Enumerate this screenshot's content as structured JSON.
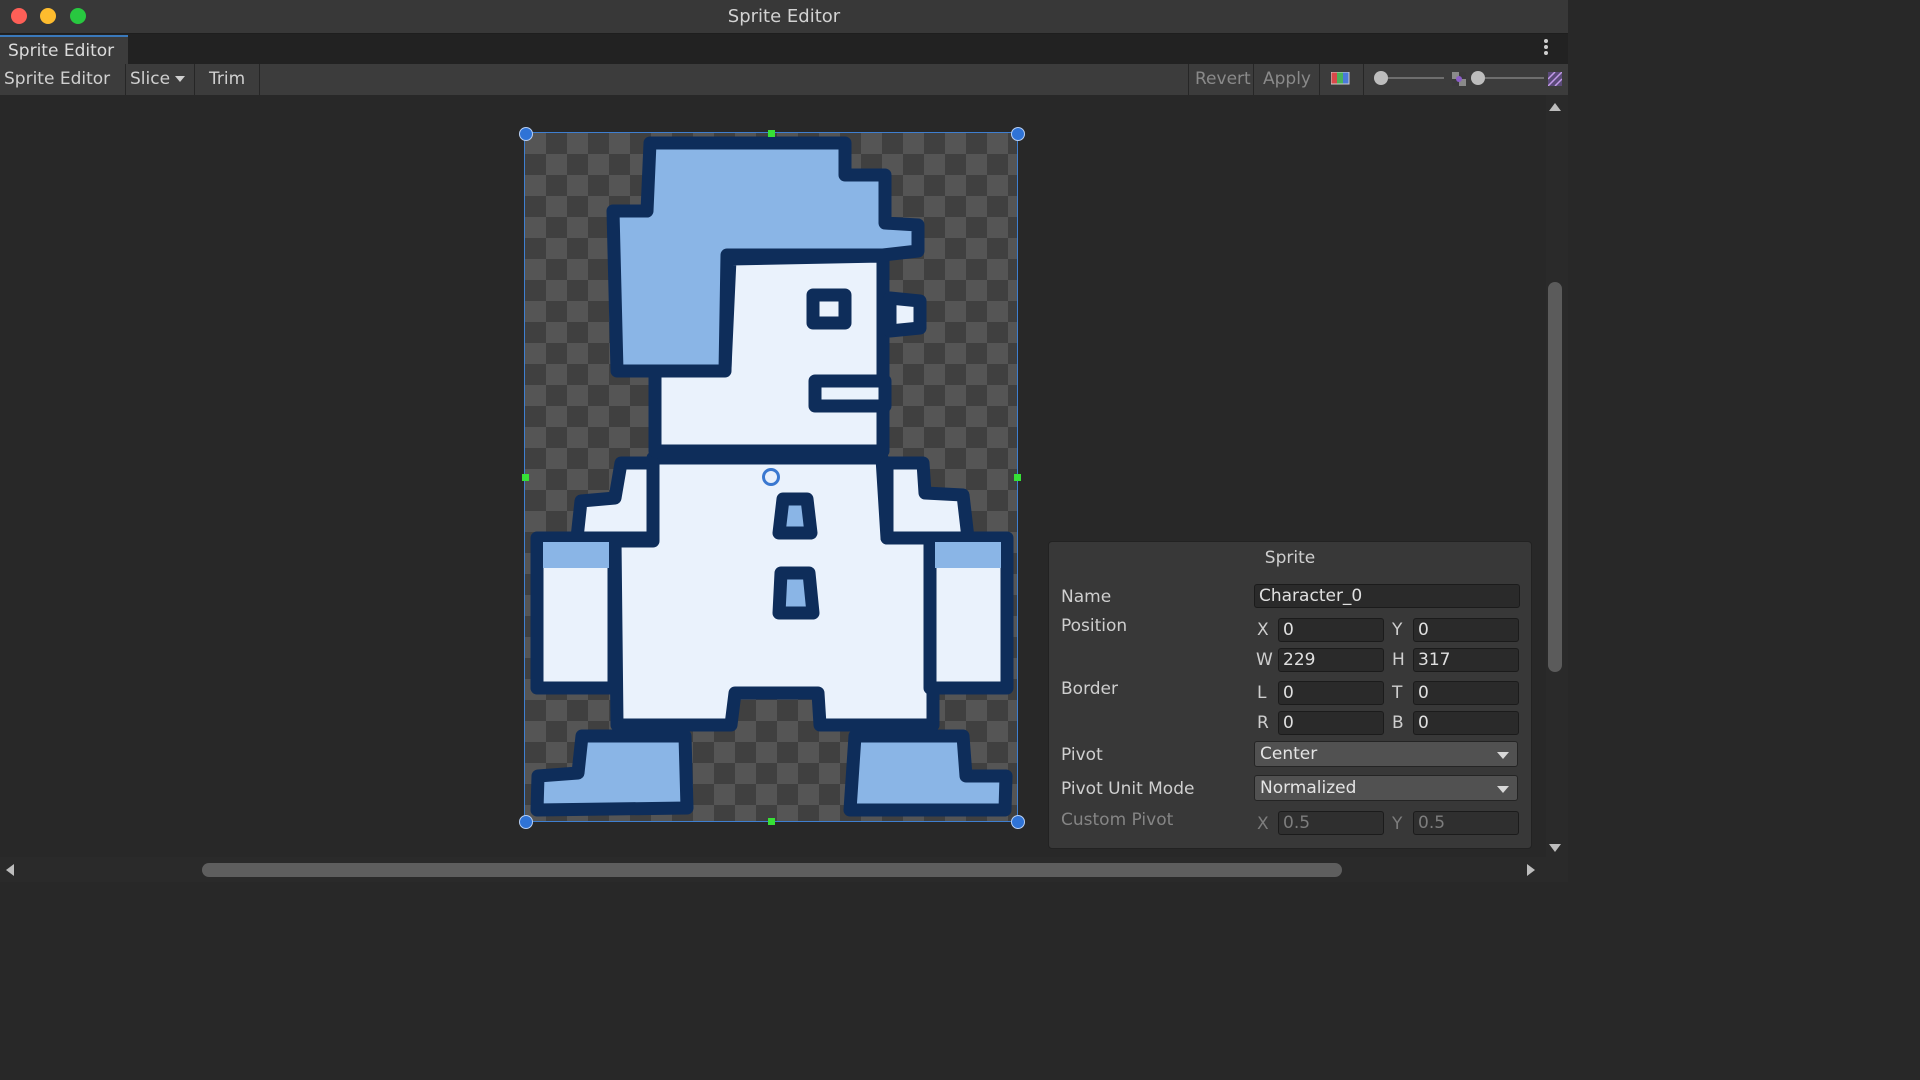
{
  "window": {
    "title": "Sprite Editor"
  },
  "tab": {
    "label": "Sprite Editor"
  },
  "toolbar": {
    "mode_label": "Sprite Editor",
    "slice_label": "Slice",
    "trim_label": "Trim",
    "revert_label": "Revert",
    "apply_label": "Apply"
  },
  "panel": {
    "title": "Sprite",
    "name_label": "Name",
    "name_value": "Character_0",
    "position_label": "Position",
    "position": {
      "x_label": "X",
      "x": "0",
      "y_label": "Y",
      "y": "0",
      "w_label": "W",
      "w": "229",
      "h_label": "H",
      "h": "317"
    },
    "border_label": "Border",
    "border": {
      "l_label": "L",
      "l": "0",
      "t_label": "T",
      "t": "0",
      "r_label": "R",
      "r": "0",
      "b_label": "B",
      "b": "0"
    },
    "pivot_label": "Pivot",
    "pivot_value": "Center",
    "pivot_unit_label": "Pivot Unit Mode",
    "pivot_unit_value": "Normalized",
    "custom_pivot_label": "Custom Pivot",
    "custom_pivot": {
      "x_label": "X",
      "x": "0.5",
      "y_label": "Y",
      "y": "0.5"
    }
  },
  "colors": {
    "selection": "#3f7fd0",
    "sprite_fill_light": "#eaf2fc",
    "sprite_fill_blue": "#8ab5e6",
    "sprite_outline": "#0e2d5a"
  }
}
